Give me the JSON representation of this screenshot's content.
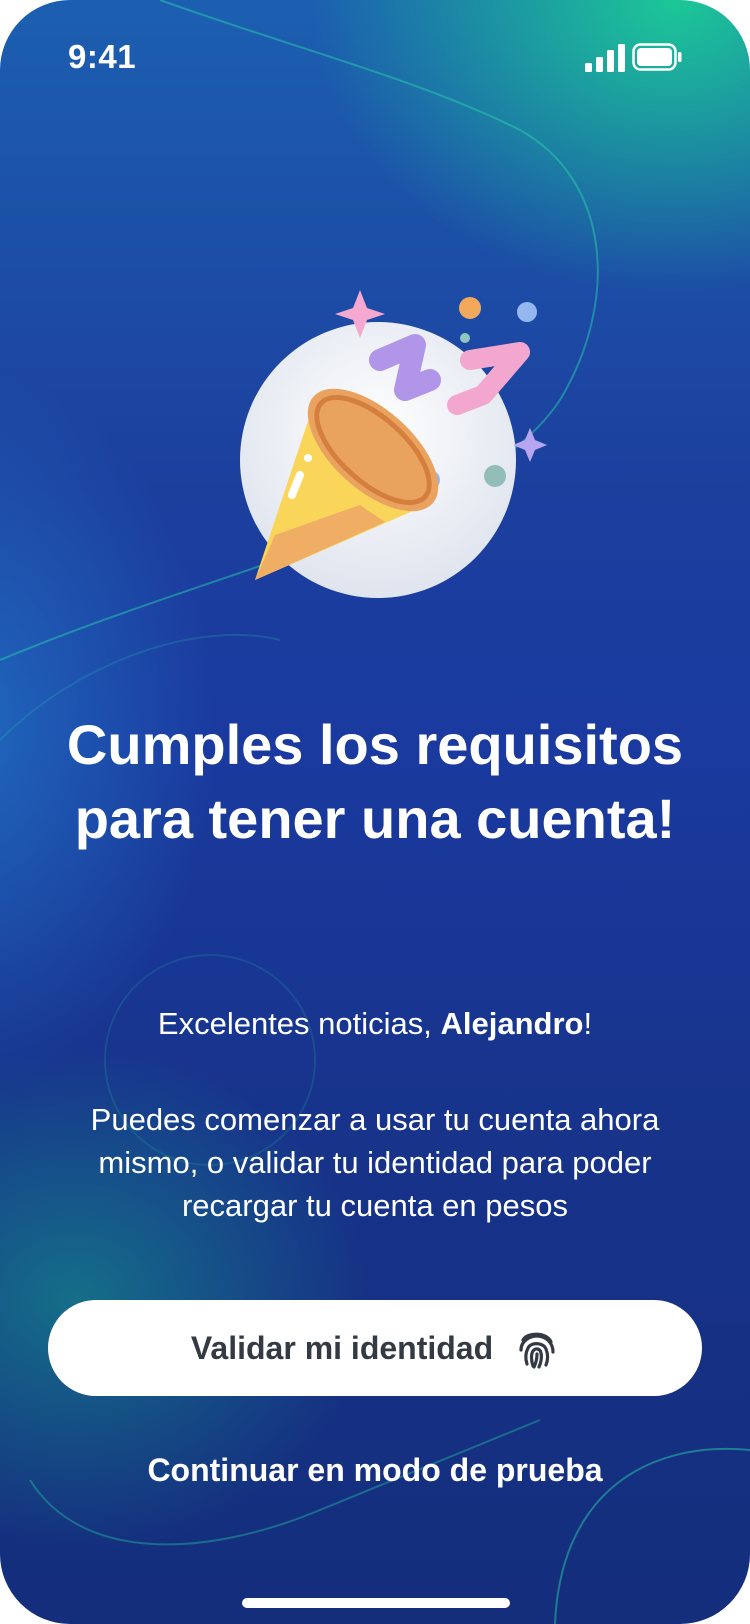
{
  "status_bar": {
    "time": "9:41",
    "signal_icon": "cellular-signal-icon",
    "battery_icon": "battery-full-icon"
  },
  "hero": {
    "icon": "party-popper-icon"
  },
  "content": {
    "title": "Cumples los requisitos para tener una cuenta!",
    "greeting_prefix": "Excelentes noticias, ",
    "greeting_name": "Alejandro",
    "greeting_suffix": "!",
    "body": "Puedes comenzar a usar tu cuenta ahora mismo, o validar tu identidad para poder recargar tu cuenta en pesos"
  },
  "actions": {
    "validate_label": "Validar mi identidad",
    "validate_icon": "fingerprint-icon",
    "trial_label": "Continuar en modo de prueba"
  },
  "colors": {
    "gradient_top": "#1c5fb0",
    "gradient_bottom": "#142e7c",
    "accent_green": "#1ccd96",
    "button_bg": "#ffffff",
    "button_text": "#333a44"
  }
}
